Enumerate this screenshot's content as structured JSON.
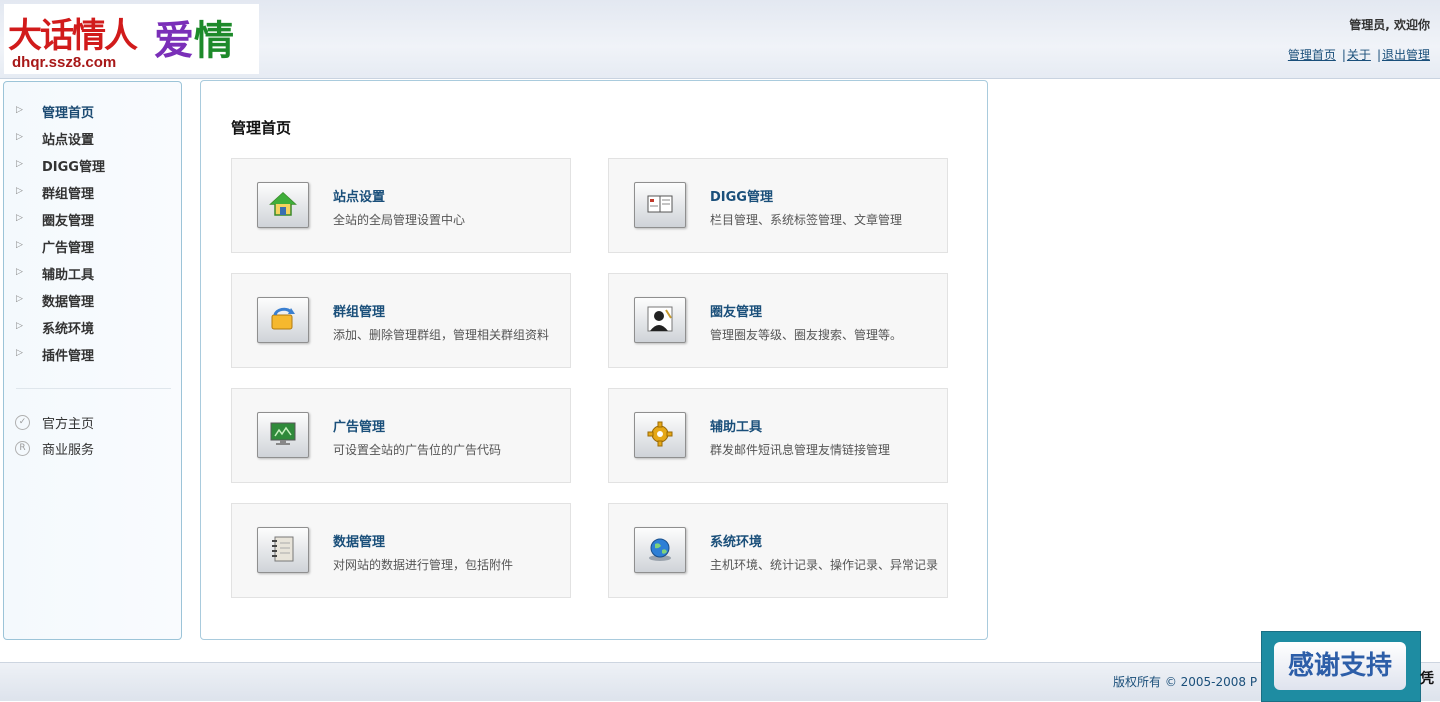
{
  "header": {
    "logo_text": "大话情人",
    "logo_love_1": "爱",
    "logo_love_2": "情",
    "logo_url": "dhqr.ssz8.com",
    "welcome": "管理员, 欢迎你",
    "links": [
      "管理首页",
      "关于",
      "退出管理"
    ],
    "separator": "|"
  },
  "sidebar": {
    "items": [
      {
        "label": "管理首页",
        "active": true
      },
      {
        "label": "站点设置"
      },
      {
        "label": "DIGG管理"
      },
      {
        "label": "群组管理"
      },
      {
        "label": "圈友管理"
      },
      {
        "label": "广告管理"
      },
      {
        "label": "辅助工具"
      },
      {
        "label": "数据管理"
      },
      {
        "label": "系统环境"
      },
      {
        "label": "插件管理"
      }
    ],
    "external": [
      {
        "label": "官方主页",
        "icon": "check-circle-icon",
        "glyph": "✓"
      },
      {
        "label": "商业服务",
        "icon": "registered-icon",
        "glyph": "R"
      }
    ]
  },
  "main": {
    "title": "管理首页",
    "cards": [
      {
        "title": "站点设置",
        "desc": "全站的全局管理设置中心",
        "icon": "home-icon"
      },
      {
        "title": "DIGG管理",
        "desc": "栏目管理、系统标签管理、文章管理",
        "icon": "book-icon"
      },
      {
        "title": "群组管理",
        "desc": "添加、删除管理群组，管理相关群组资料",
        "icon": "refresh-folder-icon"
      },
      {
        "title": "圈友管理",
        "desc": "管理圈友等级、圈友搜索、管理等。",
        "icon": "user-icon"
      },
      {
        "title": "广告管理",
        "desc": "可设置全站的广告位的广告代码",
        "icon": "monitor-icon"
      },
      {
        "title": "辅助工具",
        "desc": "群发邮件短讯息管理友情链接管理",
        "icon": "gear-icon"
      },
      {
        "title": "数据管理",
        "desc": "对网站的数据进行管理，包括附件",
        "icon": "notebook-icon"
      },
      {
        "title": "系统环境",
        "desc": "主机环境、统计记录、操作记录、异常记录",
        "icon": "globe-icon"
      }
    ]
  },
  "footer": {
    "copyright": "版权所有 © 2005-2008 P",
    "thanks": "感谢支持",
    "edge_char": "凭"
  }
}
